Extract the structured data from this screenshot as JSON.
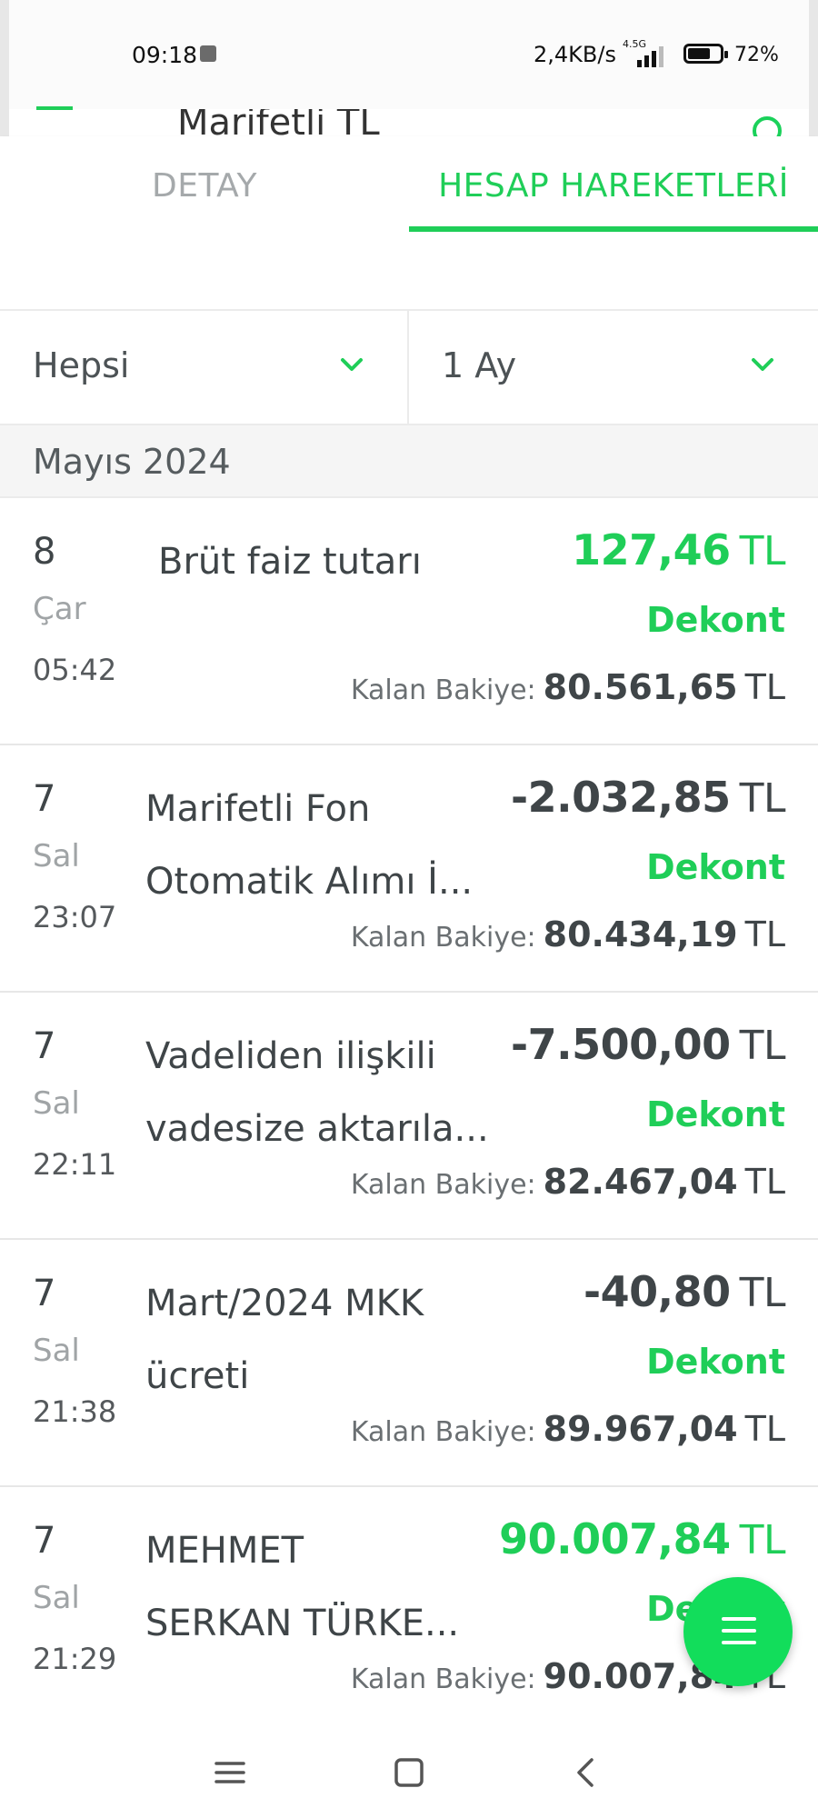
{
  "status": {
    "time": "09:18",
    "network_speed": "2,4KB/s",
    "network_type": "4.5G",
    "battery_percent": "72%",
    "battery_level": 0.72
  },
  "peek": {
    "title": "Marifetli TL"
  },
  "tabs": [
    {
      "label": "DETAY",
      "selected": false
    },
    {
      "label": "HESAP HAREKETLERİ",
      "selected": true
    }
  ],
  "filters": {
    "type": "Hepsi",
    "period": "1 Ay"
  },
  "month": "Mayıs 2024",
  "transactions": [
    {
      "day": "8",
      "dow": "Çar",
      "time": "05:42",
      "desc": [
        "Brüt faiz tutarı"
      ],
      "amount": "127,46",
      "currency": "TL",
      "positive": true,
      "dekont": "Dekont",
      "balance_label": "Kalan Bakiye:",
      "balance": "80.561,65",
      "balance_currency": "TL"
    },
    {
      "day": "7",
      "dow": "Sal",
      "time": "23:07",
      "desc": [
        "Marifetli Fon",
        "Otomatik Alımı İ..."
      ],
      "amount": "-2.032,85",
      "currency": "TL",
      "positive": false,
      "dekont": "Dekont",
      "balance_label": "Kalan Bakiye:",
      "balance": "80.434,19",
      "balance_currency": "TL"
    },
    {
      "day": "7",
      "dow": "Sal",
      "time": "22:11",
      "desc": [
        "Vadeliden ilişkili",
        "vadesize aktarıla..."
      ],
      "amount": "-7.500,00",
      "currency": "TL",
      "positive": false,
      "dekont": "Dekont",
      "balance_label": "Kalan Bakiye:",
      "balance": "82.467,04",
      "balance_currency": "TL"
    },
    {
      "day": "7",
      "dow": "Sal",
      "time": "21:38",
      "desc": [
        "Mart/2024 MKK",
        "ücreti"
      ],
      "amount": "-40,80",
      "currency": "TL",
      "positive": false,
      "dekont": "Dekont",
      "balance_label": "Kalan Bakiye:",
      "balance": "89.967,04",
      "balance_currency": "TL"
    },
    {
      "day": "7",
      "dow": "Sal",
      "time": "21:29",
      "desc": [
        "MEHMET",
        "SERKAN TÜRKE..."
      ],
      "amount": "90.007,84",
      "currency": "TL",
      "positive": true,
      "dekont": "Dekont",
      "balance_label": "Kalan Bakiye:",
      "balance": "90.007,84",
      "balance_currency": "TL"
    }
  ],
  "icons": {
    "filter_chevron": "chevron-down-icon",
    "fab": "menu-icon",
    "nav": [
      "recents-icon",
      "home-icon",
      "back-icon"
    ]
  },
  "colors": {
    "accent": "#1fce58",
    "fab": "#12dd5b",
    "text": "#3f4548",
    "muted": "#a0a4a6"
  }
}
